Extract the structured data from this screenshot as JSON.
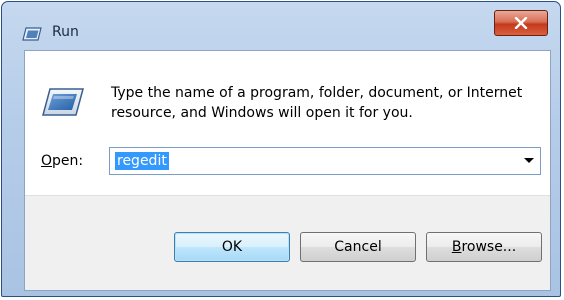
{
  "window": {
    "title": "Run",
    "close_label": "Close"
  },
  "dialog": {
    "description": "Type the name of a program, folder, document, or Internet resource, and Windows will open it for you.",
    "open_label_first": "O",
    "open_label_rest": "pen:",
    "open_value": "regedit"
  },
  "buttons": {
    "ok": "OK",
    "cancel": "Cancel",
    "browse": "Browse..."
  },
  "icons": {
    "title": "run-icon",
    "main": "run-icon",
    "close": "close-icon",
    "dropdown": "chevron-down-icon"
  },
  "colors": {
    "selection": "#3399ff",
    "close_button": "#c3391c",
    "frame": "#b6cde9"
  }
}
